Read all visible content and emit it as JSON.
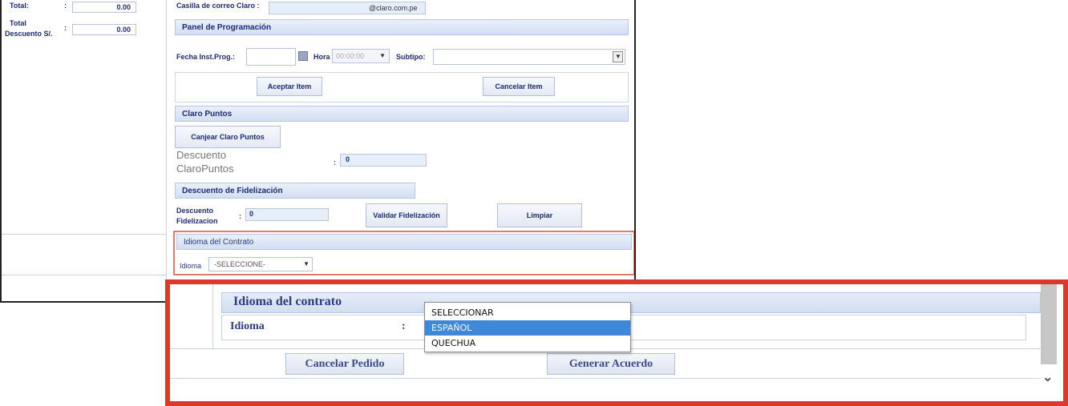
{
  "left_panel": {
    "row1_label": "Total:",
    "row1_value": "0.00",
    "row2_label_a": "Total",
    "row2_label_b": "Descuento S/.",
    "row2_colon": ":",
    "row2_value": "0.00"
  },
  "email": {
    "label": "Casilla de correo Claro :",
    "domain": "@claro.com.pe"
  },
  "programming": {
    "header": "Panel de Programación",
    "date_label": "Fecha Inst.Prog.:",
    "hour_label": "Hora",
    "hour_value": "00:00:00",
    "subtype_label": "Subtipo:",
    "accept_button": "Aceptar Item",
    "cancel_button": "Cancelar Item"
  },
  "claro_points": {
    "header": "Claro Puntos",
    "redeem_button": "Canjear Claro Puntos",
    "discount_label_a": "Descuento",
    "discount_label_b": "ClaroPuntos",
    "colon": ":",
    "value": "0"
  },
  "loyalty": {
    "header": "Descuento de Fidelización",
    "label_a": "Descuento",
    "label_b": "Fidelizacion",
    "colon": ":",
    "value": "0",
    "validate_button": "Validar Fidelización",
    "clear_button": "Limpiar"
  },
  "contract_small": {
    "header": "Idioma del Contrato",
    "label": "Idioma",
    "select_value": "-SELECCIONE-"
  },
  "contract_zoom": {
    "header": "Idioma del contrato",
    "label": "Idioma",
    "colon": ":",
    "options": [
      "SELECCIONAR",
      "ESPAÑOL",
      "QUECHUA"
    ],
    "selected": "ESPAÑOL",
    "cancel_order_button": "Cancelar Pedido",
    "generate_button": "Generar Acuerdo"
  },
  "colors": {
    "highlight": "#d93a2a",
    "dropdown_selected": "#3d89d8"
  }
}
